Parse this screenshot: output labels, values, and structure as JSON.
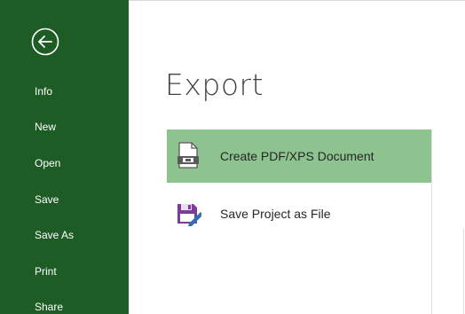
{
  "sidebar": {
    "back_icon": "back-arrow-circle-icon",
    "bg_color": "#1e5c25",
    "items": [
      {
        "label": "Info"
      },
      {
        "label": "New"
      },
      {
        "label": "Open"
      },
      {
        "label": "Save"
      },
      {
        "label": "Save As"
      },
      {
        "label": "Print"
      },
      {
        "label": "Share"
      }
    ]
  },
  "main": {
    "title": "Export",
    "export_options": [
      {
        "label": "Create PDF/XPS Document",
        "icon": "pdf-document-icon",
        "selected": true
      },
      {
        "label": "Save Project as File",
        "icon": "save-floppy-icon",
        "selected": false
      }
    ],
    "selected_color": "#8cc38f"
  }
}
